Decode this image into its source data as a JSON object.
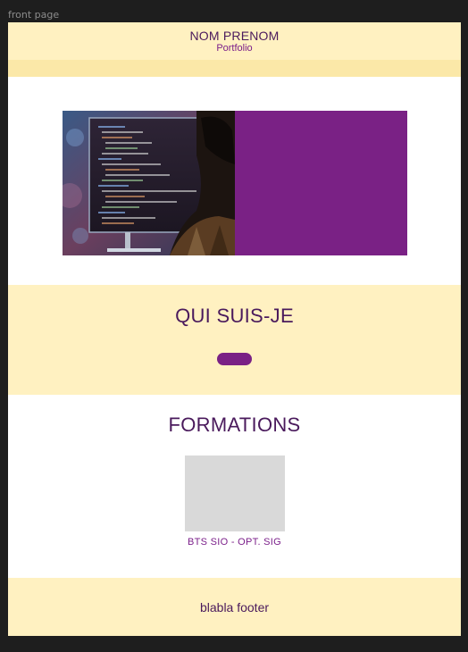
{
  "canvas": {
    "frame_label": "front page",
    "frame_label_bottom": "..."
  },
  "header": {
    "name": "NOM PRENOM",
    "subtitle": "Portfolio"
  },
  "sections": {
    "about": {
      "title": "QUI SUIS-JE"
    },
    "formations": {
      "title": "FORMATIONS",
      "items": [
        {
          "label": "BTS SIO - OPT. SIG"
        }
      ]
    }
  },
  "footer": {
    "text": "blabla footer"
  },
  "colors": {
    "cream": "#fff1c1",
    "cream_strip": "#fbe8a8",
    "purple": "#7a2185",
    "dark_purple": "#4a1a5c",
    "placeholder_gray": "#d9d9d9",
    "canvas": "#1e1e1e"
  }
}
